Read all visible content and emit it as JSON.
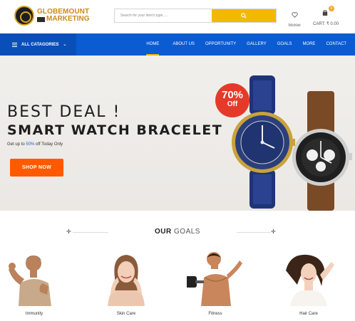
{
  "header": {
    "logo": {
      "line1": "GLOBEMOUNT",
      "line2": "MARKETING"
    },
    "search": {
      "placeholder": "Search for your item's type.....",
      "button_icon": "search-icon"
    },
    "wishlist": {
      "label": "Wishlist",
      "icon": "heart-icon"
    },
    "cart": {
      "label": "CART: ₹ 0.00",
      "count": "0",
      "icon": "bag-icon"
    }
  },
  "nav": {
    "categories_label": "ALL CATAGORIES",
    "items": [
      {
        "label": "HOME",
        "active": true
      },
      {
        "label": "ABOUT US",
        "active": false
      },
      {
        "label": "OPPORTUNITY",
        "active": false
      },
      {
        "label": "GALLERY",
        "active": false
      },
      {
        "label": "GOALS",
        "active": false
      },
      {
        "label": "MORE",
        "active": false
      },
      {
        "label": "CONTACT",
        "active": false
      }
    ]
  },
  "hero": {
    "title1": "BEST DEAL !",
    "title2": "SMART WATCH BRACELET",
    "subtitle_prefix": "Get up to ",
    "subtitle_highlight": "50%",
    "subtitle_suffix": " off Today Only",
    "cta": "SHOP NOW",
    "badge_percent": "70%",
    "badge_off": "Off"
  },
  "goals": {
    "title_bold": "OUR",
    "title_light": "GOALS",
    "items": [
      {
        "label": "Immunity"
      },
      {
        "label": "Skin Care"
      },
      {
        "label": "Fitness"
      },
      {
        "label": "Hair Care"
      }
    ]
  },
  "colors": {
    "nav_blue": "#0b5bd3",
    "accent_yellow": "#f5b800",
    "cta_orange": "#ff5a00",
    "badge_red": "#e53a2a",
    "logo_gold": "#c98b16"
  }
}
